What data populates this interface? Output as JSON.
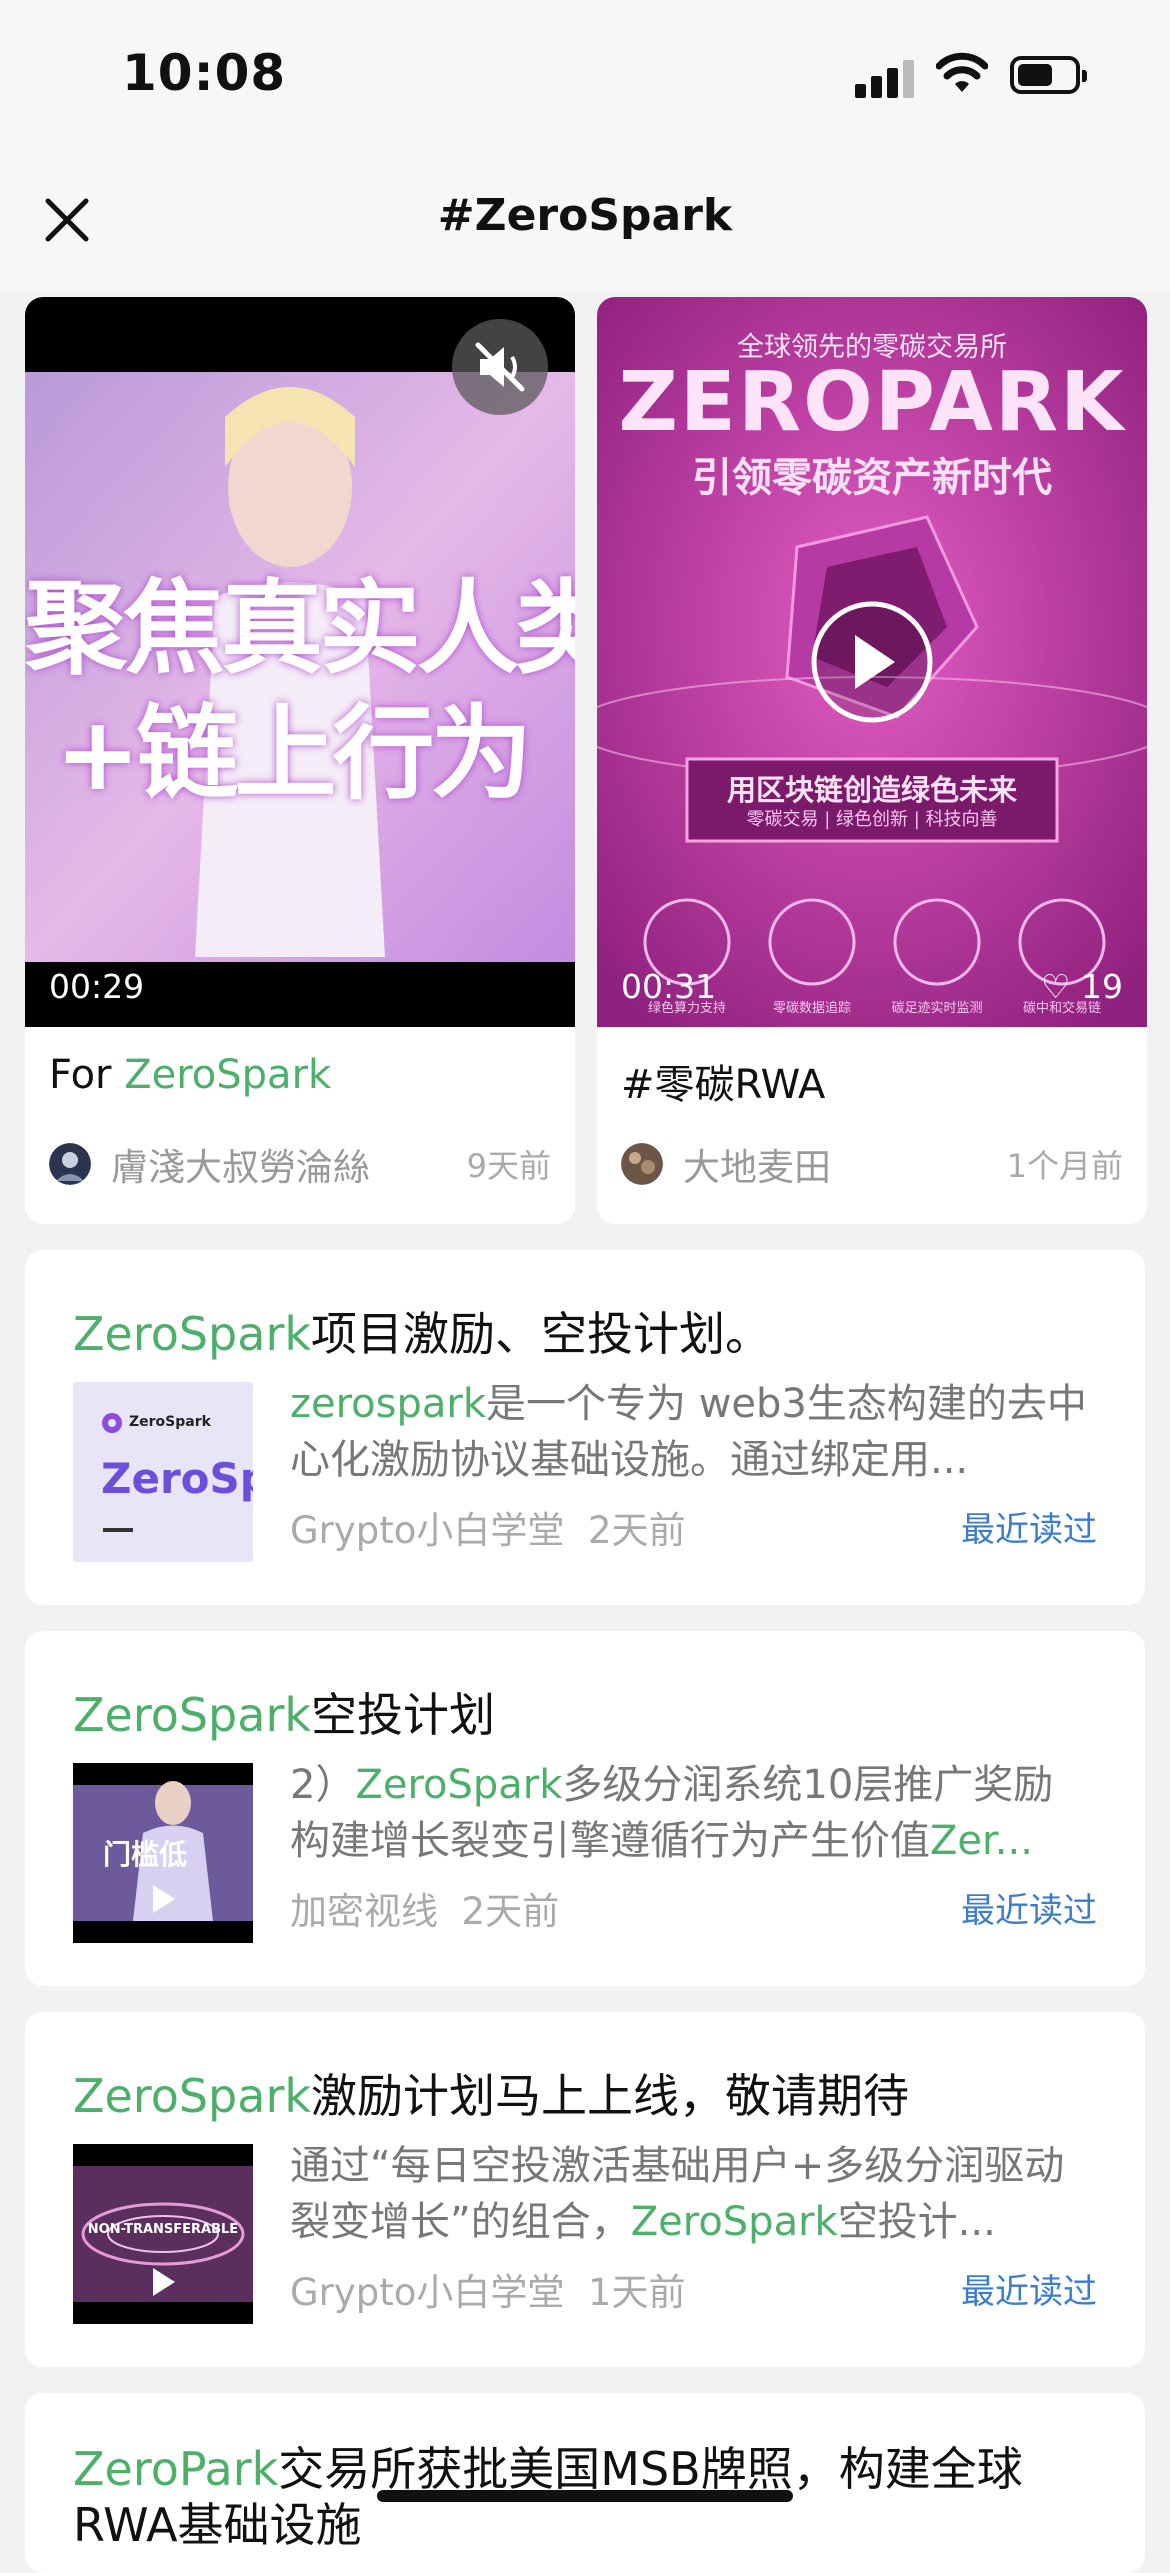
{
  "status_bar": {
    "time": "10:08"
  },
  "nav": {
    "title": "#ZeroSpark"
  },
  "videos": [
    {
      "duration": "00:29",
      "caption_prefix": "For ",
      "caption_highlight": "ZeroSpark",
      "author": "膚淺大叔勞淪絲",
      "time": "9天前",
      "overlay_text_1": "聚焦真实人类",
      "overlay_text_2": "+链上行为"
    },
    {
      "duration": "00:31",
      "likes": "19",
      "caption": "#零碳RWA",
      "author": "大地麦田",
      "time": "1个月前",
      "poster_line1": "全球领先的零碳交易所",
      "poster_title": "ZEROPARK",
      "poster_subtitle": "引领零碳资产新时代",
      "poster_banner": "用区块链创造绿色未来",
      "poster_banner_sub": "零碳交易 | 绿色创新 | 科技向善",
      "poster_icons": [
        "绿色算力支持",
        "零碳数据追踪",
        "碳足迹实时监测",
        "碳中和交易链"
      ]
    }
  ],
  "articles": [
    {
      "title_highlight": "ZeroSpark",
      "title_rest": "项目激励、空投计划。",
      "snippet_highlight": "zerospark",
      "snippet_rest": "是一个专为 web3生态构建的去中心化激励协议基础设施。通过绑定用...",
      "source": "Grypto小白学堂",
      "time": "2天前",
      "read": "最近读过",
      "thumb_brand": "ZeroSpark",
      "thumb_text": "ZeroSp"
    },
    {
      "title_highlight": "ZeroSpark",
      "title_rest": "空投计划",
      "snippet_pre": "2）",
      "snippet_highlight": "ZeroSpark",
      "snippet_rest": "多级分润系统10层推广奖励构建增长裂变引擎遵循行为产生价值",
      "snippet_tail": "Zer...",
      "source": "加密视线",
      "time": "2天前",
      "read": "最近读过",
      "thumb_text": "门槛低"
    },
    {
      "title_highlight": "ZeroSpark",
      "title_rest": "激励计划马上上线，敬请期待",
      "snippet_pre": "通过“每日空投激活基础用户+多级分润驱动裂变增长”的组合，",
      "snippet_highlight": "ZeroSpark",
      "snippet_rest": "空投计...",
      "source": "Grypto小白学堂",
      "time": "1天前",
      "read": "最近读过",
      "thumb_text": "NON-TRANSFERABLE"
    },
    {
      "title_highlight": "ZeroPark",
      "title_rest": "交易所获批美国MSB牌照，构建全球RWA基础设施"
    }
  ],
  "colors": {
    "accent_green": "#4caf6a",
    "link_blue": "#3c7ccf"
  }
}
